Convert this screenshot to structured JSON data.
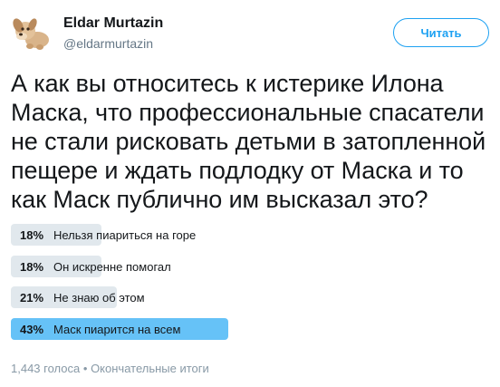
{
  "author": {
    "display_name": "Eldar Murtazin",
    "handle": "@eldarmurtazin",
    "avatar_icon": "plush-dog-avatar-icon"
  },
  "follow_button": {
    "label": "Читать"
  },
  "tweet": {
    "text": "А как вы относитесь к истерике Илона Маска, что профессиональные спасатели не стали рисковать детьми в затопленной пещере и ждать подлодку от Маска и то как Маск публично им высказал это?"
  },
  "poll": {
    "options": [
      {
        "percent_label": "18%",
        "percent": 18,
        "label": "Нельзя пиариться на горе",
        "winner": false
      },
      {
        "percent_label": "18%",
        "percent": 18,
        "label": "Он искренне помогал",
        "winner": false
      },
      {
        "percent_label": "21%",
        "percent": 21,
        "label": "Не знаю об этом",
        "winner": false
      },
      {
        "percent_label": "43%",
        "percent": 43,
        "label": "Маск пиарится на всем",
        "winner": true
      }
    ],
    "votes": "1,443 голоса",
    "separator": "•",
    "status": "Окончательные итоги"
  },
  "colors": {
    "accent": "#1da1f2",
    "poll_bar": "#e1e8ed",
    "poll_winner_bar": "#66c2f7",
    "muted_text": "#657786"
  }
}
